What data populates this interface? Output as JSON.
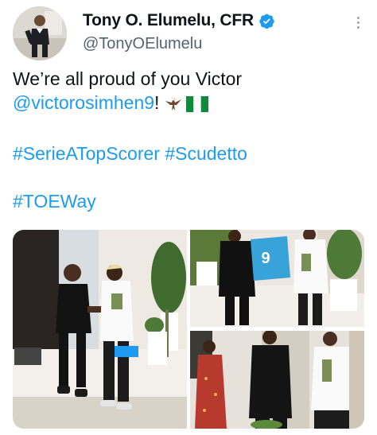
{
  "author": {
    "display_name": "Tony O. Elumelu, CFR",
    "handle": "@TonyOElumelu",
    "verified": true,
    "verified_color": "#1d9bf0",
    "avatar_icon": "profile-photo"
  },
  "more_icon": "more-vertical-icon",
  "tweet": {
    "line1": "We’re all proud of you Victor",
    "mention": "@victorosimhen9",
    "mention_suffix": "!",
    "emojis": [
      "eagle-emoji",
      "nigeria-flag-emoji"
    ],
    "hashtag_line_1": [
      "#SerieATopScorer",
      "#Scudetto"
    ],
    "hashtag_line_2": "#TOEWay"
  },
  "media": {
    "photos": [
      {
        "name": "handshake-photo",
        "jersey_number": ""
      },
      {
        "name": "jersey-presentation-photo",
        "jersey_number": "9"
      },
      {
        "name": "group-photo",
        "jersey_number": ""
      }
    ]
  },
  "colors": {
    "link": "#1d9bf0",
    "text": "#0f1419",
    "secondary_text": "#536471"
  }
}
